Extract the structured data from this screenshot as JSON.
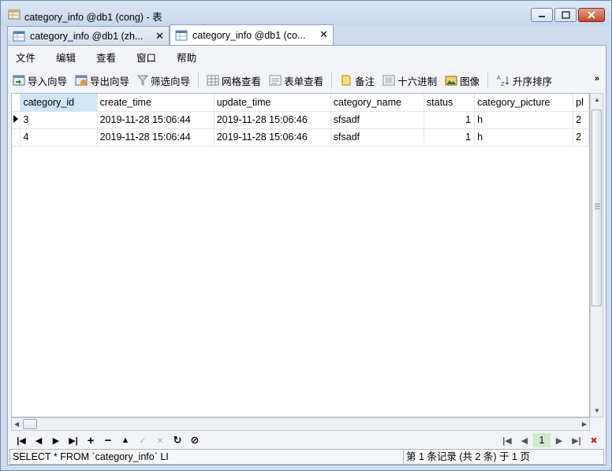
{
  "window": {
    "title": "category_info @db1 (cong) - 表"
  },
  "tabs": [
    {
      "label": "category_info @db1 (zh..."
    },
    {
      "label": "category_info @db1 (co..."
    }
  ],
  "menu": [
    "文件",
    "编辑",
    "查看",
    "窗口",
    "帮助"
  ],
  "toolbar": {
    "import": "导入向导",
    "export": "导出向导",
    "filter": "筛选向导",
    "grid_view": "网格查看",
    "form_view": "表单查看",
    "memo": "备注",
    "hex": "十六进制",
    "image": "图像",
    "sort": "升序排序",
    "more": "»"
  },
  "table": {
    "columns": [
      "category_id",
      "create_time",
      "update_time",
      "category_name",
      "status",
      "category_picture",
      "pl"
    ],
    "rows": [
      [
        "3",
        "2019-11-28 15:06:44",
        "2019-11-28 15:06:46",
        "sfsadf",
        "1",
        "h",
        "2"
      ],
      [
        "4",
        "2019-11-28 15:06:44",
        "2019-11-28 15:06:46",
        "sfsadf",
        "1",
        "h",
        "2"
      ]
    ]
  },
  "nav": {
    "page": "1"
  },
  "status": {
    "sql": "SELECT * FROM `category_info` LI",
    "record": "第 1 条记录 (共 2 条) 于 1 页"
  },
  "colors": {
    "selected_header": "#cfe6f8",
    "page_box": "#cfe8cf"
  }
}
